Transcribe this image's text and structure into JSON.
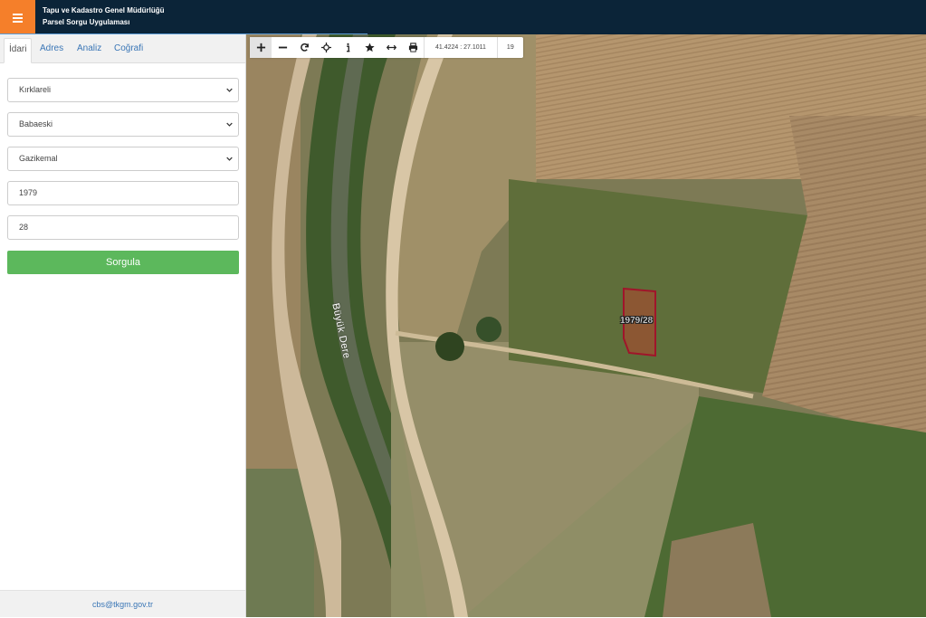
{
  "header": {
    "title_line1": "Tapu ve Kadastro Genel Müdürlüğü",
    "title_line2": "Parsel Sorgu Uygulaması",
    "menu_icon": "hamburger-icon",
    "accent_color": "#f57f2a",
    "background_color": "#0b2438"
  },
  "sidebar": {
    "tabs": [
      {
        "label": "İdari",
        "active": true
      },
      {
        "label": "Adres",
        "active": false
      },
      {
        "label": "Analiz",
        "active": false
      },
      {
        "label": "Coğrafi",
        "active": false
      }
    ],
    "form": {
      "province": "Kırklareli",
      "district": "Babaeski",
      "neighborhood": "Gazikemal",
      "block": "1979",
      "parcel": "28"
    },
    "submit_label": "Sorgula",
    "submit_color": "#5cb85c",
    "footer_email": "cbs@tkgm.gov.tr"
  },
  "map": {
    "toolbar": {
      "tools": [
        "plus-icon",
        "minus-icon",
        "refresh-icon",
        "locate-icon",
        "info-icon",
        "star-icon",
        "measure-icon",
        "print-icon"
      ],
      "coordinates": "41.4224 : 27.1011",
      "zoom_level": "19"
    },
    "river_label": "Büyük Dere",
    "parcel_label": "1979/28",
    "parcel_color": "#a0152a"
  }
}
